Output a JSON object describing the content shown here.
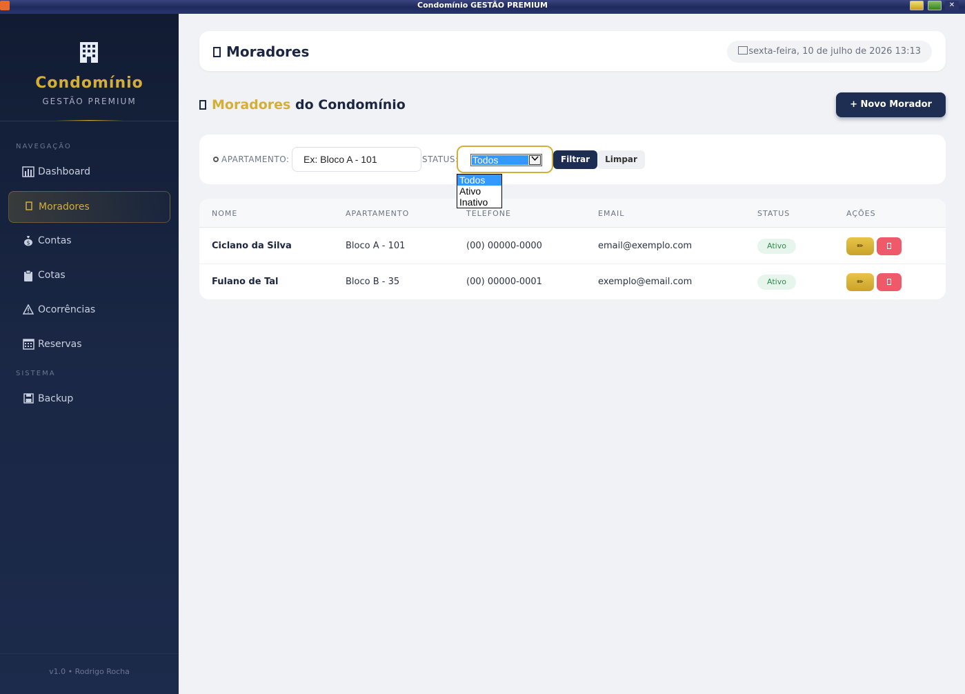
{
  "window": {
    "title": "Condomínio GESTÃO PREMIUM"
  },
  "sidebar": {
    "brand_name": "Condomínio",
    "brand_sub": "GESTÃO PREMIUM",
    "nav_label": "NAVEGAÇÃO",
    "system_label": "SISTEMA",
    "items": [
      {
        "label": "Dashboard",
        "icon": "chart-icon"
      },
      {
        "label": "Moradores",
        "icon": "person-icon"
      },
      {
        "label": "Contas",
        "icon": "money-bag-icon"
      },
      {
        "label": "Cotas",
        "icon": "clipboard-icon"
      },
      {
        "label": "Ocorrências",
        "icon": "warning-icon"
      },
      {
        "label": "Reservas",
        "icon": "calendar-icon"
      }
    ],
    "system_items": [
      {
        "label": "Backup",
        "icon": "floppy-icon"
      }
    ],
    "footer": "v1.0 • Rodrigo Rocha"
  },
  "header": {
    "title": "Moradores",
    "date": "sexta-feira, 10 de julho de 2026 13:13"
  },
  "section": {
    "title_highlight": "Moradores",
    "title_rest": " do Condomínio",
    "new_button": "+ Novo Morador"
  },
  "filters": {
    "apartment_label": "APARTAMENTO:",
    "apartment_placeholder": "Ex: Bloco A - 101",
    "status_label": "STATUS:",
    "status_value": "Todos",
    "status_options": [
      "Todos",
      "Ativo",
      "Inativo"
    ],
    "filter_button": "Filtrar",
    "clear_button": "Limpar"
  },
  "table": {
    "headers": [
      "NOME",
      "APARTAMENTO",
      "TELEFONE",
      "EMAIL",
      "STATUS",
      "AÇÕES"
    ],
    "rows": [
      {
        "name": "Ciclano da Silva",
        "apartment": "Bloco A - 101",
        "phone": "(00) 00000-0000",
        "email": "email@exemplo.com",
        "status": "Ativo"
      },
      {
        "name": "Fulano de Tal",
        "apartment": "Bloco B - 35",
        "phone": "(00) 00000-0001",
        "email": "exemplo@email.com",
        "status": "Ativo"
      }
    ]
  },
  "colors": {
    "accent": "#d4af37",
    "navy": "#1e2d52",
    "danger": "#ef5a6a",
    "success": "#2e8b4e"
  }
}
